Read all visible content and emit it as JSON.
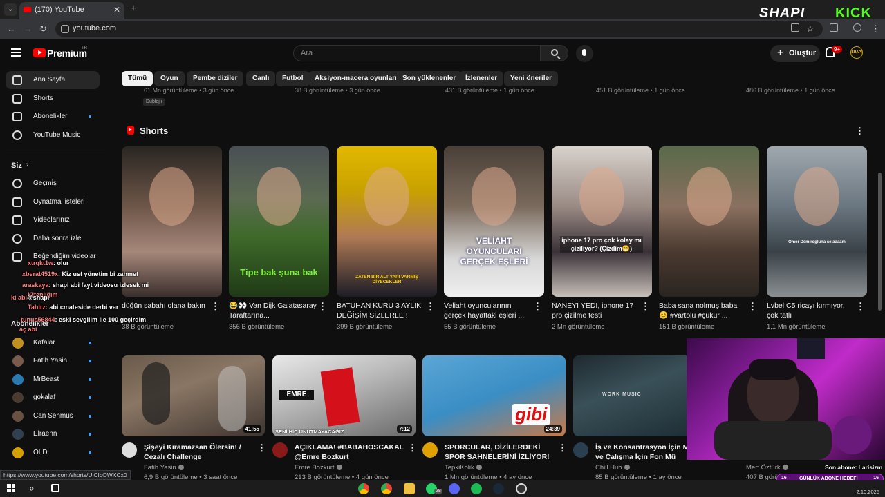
{
  "browser": {
    "tab_title": "(170) YouTube",
    "url": "youtube.com",
    "brand_left": "SHAPI",
    "brand_right": "KICK"
  },
  "topbar": {
    "logo_text": "Premium",
    "logo_suffix": "TR",
    "search_placeholder": "Ara",
    "create_label": "Oluştur",
    "notif_count": "9+",
    "avatar_text": "SHAPI"
  },
  "chips": [
    "Tümü",
    "Oyun",
    "Pembe diziler",
    "Canlı",
    "Futbol",
    "Aksiyon-macera oyunları",
    "Son yüklenenler",
    "İzlenenler",
    "Yeni öneriler"
  ],
  "sidebar": {
    "main": [
      {
        "label": "Ana Sayfa",
        "icon": "home-icon"
      },
      {
        "label": "Shorts",
        "icon": "shorts-icon"
      },
      {
        "label": "Abonelikler",
        "icon": "subscriptions-icon"
      },
      {
        "label": "YouTube Music",
        "icon": "music-icon"
      }
    ],
    "you_header": "Siz",
    "you": [
      {
        "label": "Geçmiş",
        "icon": "history-icon"
      },
      {
        "label": "Oynatma listeleri",
        "icon": "playlists-icon"
      },
      {
        "label": "Videolarınız",
        "icon": "your-videos-icon"
      },
      {
        "label": "Daha sonra izle",
        "icon": "watch-later-icon"
      },
      {
        "label": "Beğendiğim videolar",
        "icon": "liked-icon"
      }
    ],
    "subs_header": "Abonelikler",
    "subs": [
      {
        "label": "Kafalar",
        "color": "#c09020"
      },
      {
        "label": "Fatih Yasin",
        "color": "#7a5a4a"
      },
      {
        "label": "MrBeast",
        "color": "#2a7ab0"
      },
      {
        "label": "gokalaf",
        "color": "#4a3a30"
      },
      {
        "label": "Can Sehmus",
        "color": "#6a5040"
      },
      {
        "label": "Elraenn",
        "color": "#304050"
      },
      {
        "label": "OLD",
        "color": "#d4a000"
      }
    ]
  },
  "chat": [
    {
      "name": "xtrqkt1w",
      "text": ": olur"
    },
    {
      "name": "xberat4519x",
      "text": ": Kiz ust yönetim bi zahmet"
    },
    {
      "name": "araskaya",
      "text": ": shapi abi fayt videosu izlesek mi"
    },
    {
      "name": "Kitaplığım",
      "text": ""
    },
    {
      "name": "ki abi",
      "text": "@shapi"
    },
    {
      "name": "Tahirz",
      "text": ": abi cmateside derbi var"
    },
    {
      "name": "tunus56844",
      "text": ": eski sevgilim ile 100 geçirdim"
    },
    {
      "name": "aç abi",
      "text": ""
    }
  ],
  "faded_row": [
    "61 Mn görüntüleme • 3 gün önce",
    "38 B görüntüleme • 3 gün önce",
    "431 B görüntüleme • 1 gün önce",
    "451 B görüntüleme • 1 gün önce",
    "486 B görüntüleme • 1 gün önce"
  ],
  "dub_badge": "Dublajlı",
  "shorts": {
    "title": "Shorts",
    "items": [
      {
        "title": "düğün sabahı olana bakın",
        "views": "38 B görüntüleme",
        "caption": ""
      },
      {
        "title": "😂👀 Van Dijk Galatasaray Taraftarına...",
        "views": "356 B görüntüleme",
        "caption": "Tipe bak şuna bak"
      },
      {
        "title": "BATUHAN KURU 3 AYLIK DEĞİŞİM SİZLERLE !",
        "views": "399 B görüntüleme",
        "caption": "ZATEN BİR ALT YAPI VARMIŞ DİYECEKLER"
      },
      {
        "title": "Veliaht oyuncularının gerçek hayattaki eşleri ...",
        "views": "55 B görüntüleme",
        "caption": "VELİAHT OYUNCULARI GERÇEK EŞLERİ"
      },
      {
        "title": "NANEYİ YEDİ, iphone 17 pro çizilme testi",
        "views": "2 Mn görüntüleme",
        "caption": "iphone 17 pro çok kolay mı çiziliyor? (Çizdim😁)"
      },
      {
        "title": "Baba sana nolmuş baba 😊 #vartolu #çukur ...",
        "views": "151 B görüntüleme",
        "caption": ""
      },
      {
        "title": "Lvbel C5 ricayı kırmıyor, çok tatlı",
        "views": "1,1 Mn görüntüleme",
        "caption": "Omer Demirogluna selaaaam"
      }
    ]
  },
  "videos": [
    {
      "title": "Şişeyi Kıramazsan Ölersin! / Cezalı Challenge",
      "channel": "Fatih Yasin",
      "meta": "6,9 B görüntüleme • 3 saat önce",
      "duration": "41:55"
    },
    {
      "title": "AÇIKLAMA! #BABAHOSCAKAL @Emre Bozkurt",
      "channel": "Emre Bozkurt",
      "meta": "213 B görüntüleme • 4 gün önce",
      "duration": "7:12",
      "caption": "SENİ HİÇ UNUTMAYACAĞIZ",
      "logo": "EMRE"
    },
    {
      "title": "SPORCULAR, DİZİLERDEKİ SPOR SAHNELERİNİ İZLİYOR!",
      "channel": "TepkiKolik",
      "meta": "1 Mn görüntüleme • 4 ay önce",
      "duration": "24:39",
      "caption": "gibi"
    },
    {
      "title": "İş ve Konsantrasyon İçin Mü Ofis ve Çalışma İçin Fon Mü",
      "channel": "Chill Hub",
      "meta": "85 B görüntüleme • 1 ay önce",
      "duration": "",
      "caption": "WORK MUSIC"
    },
    {
      "title": "",
      "channel": "Mert Öztürk",
      "meta": "407 B görüntüleme",
      "duration": ""
    }
  ],
  "stream": {
    "son_abone": "Son abone: Larisizm",
    "goal_left": "16",
    "goal_label": "GÜNLÜK ABONE HEDEFİ",
    "goal_right": "16"
  },
  "status_url": "https://www.youtube.com/shorts/UiCIcOWXCx0",
  "taskbar": {
    "date": "2.10.2025",
    "badge": "28"
  }
}
